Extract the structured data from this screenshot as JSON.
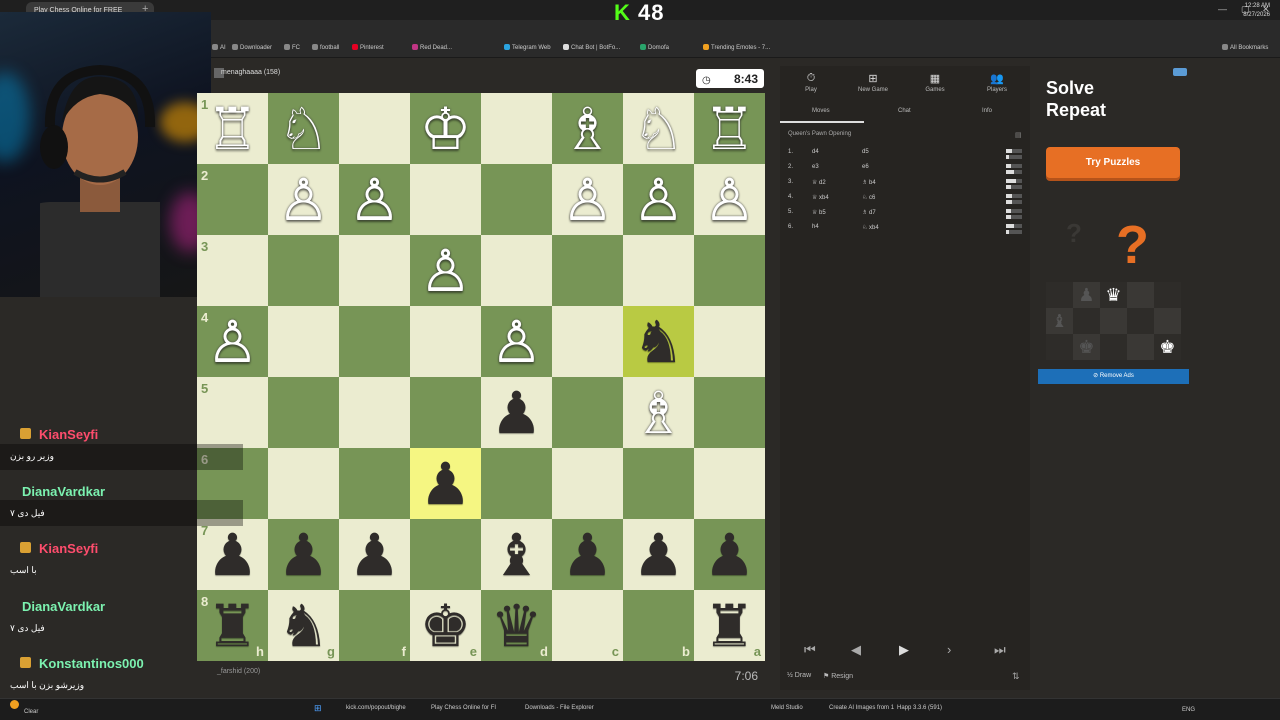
{
  "browser": {
    "tab_title": "Play Chess Online for FREE",
    "bookmarks": [
      "AI",
      "Downloader",
      "FC",
      "football",
      "Pinterest",
      "Red Dead...",
      "Telegram Web",
      "Chat Bot | BotFo...",
      "Domofa",
      "Trending Emotes - 7...",
      "All Bookmarks"
    ],
    "bookmark_colors": [
      "#888",
      "#888",
      "#888",
      "#888",
      "#e60023",
      "#c13584",
      "#2aa3df",
      "#ddd",
      "#29a36a",
      "#f0a020",
      "#888"
    ]
  },
  "overlay": {
    "logo_k": "K",
    "logo_num": "48"
  },
  "game": {
    "top_player": "menaghaaaa (158)",
    "top_clock": "8:43",
    "bottom_player": "_farshid (200)",
    "bottom_clock": "7:06",
    "ranks": [
      "1",
      "2",
      "3",
      "4",
      "5",
      "6",
      "7",
      "8"
    ],
    "files": [
      "h",
      "g",
      "f",
      "e",
      "d",
      "c",
      "b",
      "a"
    ],
    "pieces": [
      [
        "♖",
        "♘",
        "",
        "♔",
        "",
        "♗",
        "♘",
        "♖"
      ],
      [
        "",
        "♙",
        "♙",
        "",
        "",
        "♙",
        "♙",
        "♙"
      ],
      [
        "",
        "",
        "",
        "♙",
        "",
        "",
        "",
        ""
      ],
      [
        "♙",
        "",
        "",
        "",
        "♙",
        "",
        "♞",
        ""
      ],
      [
        "",
        "",
        "",
        "",
        "♟",
        "",
        "♗",
        ""
      ],
      [
        "",
        "",
        "",
        "♟",
        "",
        "",
        "",
        ""
      ],
      [
        "♟",
        "♟",
        "♟",
        "",
        "♝",
        "♟",
        "♟",
        "♟"
      ],
      [
        "♜",
        "♞",
        "",
        "♚",
        "♛",
        "",
        "",
        "♜"
      ]
    ]
  },
  "panel": {
    "nav": [
      {
        "icon": "⏱",
        "label": "Play"
      },
      {
        "icon": "⊞",
        "label": "New Game"
      },
      {
        "icon": "▦",
        "label": "Games"
      },
      {
        "icon": "👥",
        "label": "Players"
      }
    ],
    "tabs": [
      "Moves",
      "Chat",
      "Info"
    ],
    "opening": "Queen's Pawn Opening",
    "moves": [
      {
        "n": "1.",
        "w": "d4",
        "b": "d5",
        "wt": 0.4,
        "bt": 0.2
      },
      {
        "n": "2.",
        "w": "e3",
        "b": "e6",
        "wt": 0.3,
        "bt": 0.5
      },
      {
        "n": "3.",
        "w": "♕ d2",
        "b": "♗ b4",
        "wt": 0.6,
        "bt": 0.3
      },
      {
        "n": "4.",
        "w": "♕ xb4",
        "b": "♘ c6",
        "wt": 0.4,
        "bt": 0.4
      },
      {
        "n": "5.",
        "w": "♕ b5",
        "b": "♗ d7",
        "wt": 0.3,
        "bt": 0.3
      },
      {
        "n": "6.",
        "w": "h4",
        "b": "♘ xb4",
        "wt": 0.5,
        "bt": 0.2
      }
    ],
    "draw": "Draw",
    "resign": "Resign"
  },
  "ad": {
    "title_1": "Solve",
    "title_2": "Repeat",
    "button": "Try Puzzles",
    "remove": "Remove Ads",
    "question": "?"
  },
  "chat": [
    {
      "name": "KianSeyfi",
      "msg": "وزیر رو بزن",
      "color": "#ff4d6d"
    },
    {
      "name": "DianaVardkar",
      "msg": "فیل دی ۷",
      "color": "#7cf2b0"
    },
    {
      "name": "KianSeyfi",
      "msg": "با اسب",
      "color": "#ff4d6d"
    },
    {
      "name": "DianaVardkar",
      "msg": "فیل دی ۷",
      "color": "#7cf2b0"
    },
    {
      "name": "Konstantinos000",
      "msg": "وزیرشو بزن با اسب",
      "color": "#7cf2b0"
    }
  ],
  "taskbar": {
    "weather": "Clear",
    "items": [
      "kick.com/popout/bighe",
      "Play Chess Online for FI",
      "Downloads - File Explorer",
      "Meld Studio",
      "Create AI Images from 1",
      "Happ 3.3.6 (591)"
    ],
    "lang": "ENG",
    "time": "12:28 AM",
    "date": "8/27/2026"
  }
}
